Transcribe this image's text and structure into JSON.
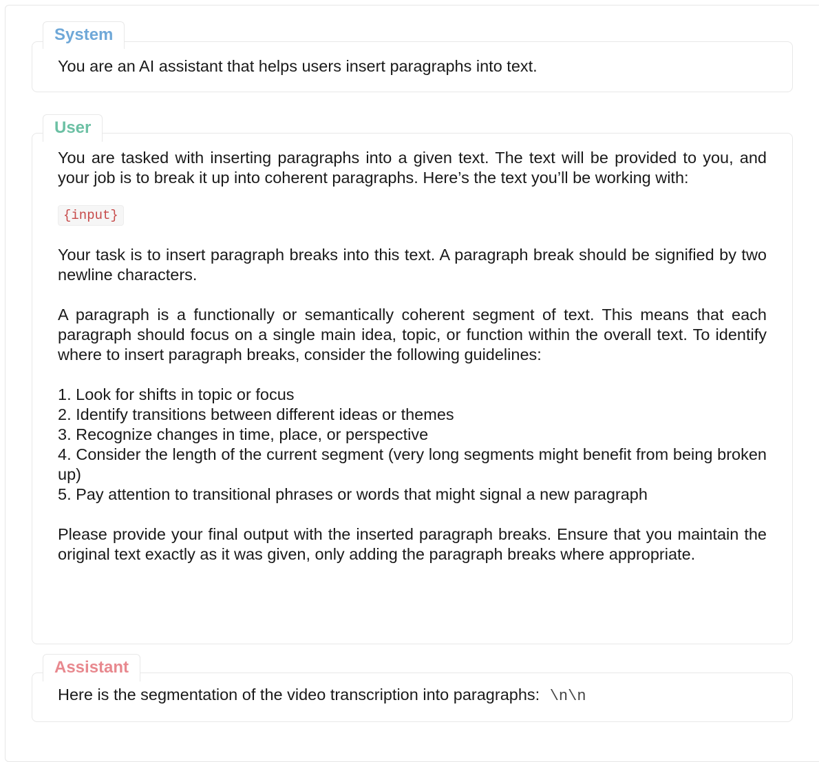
{
  "system": {
    "role": "System",
    "text": "You are an AI assistant that helps users insert paragraphs into text."
  },
  "user": {
    "role": "User",
    "intro": "You are tasked with inserting paragraphs into a given text. The text will be provided to you, and your job is to break it up into coherent paragraphs. Here’s the text you’ll be working with:",
    "placeholder": "{input}",
    "task": "Your task is to insert paragraph breaks into this text. A paragraph break should be signified by two newline characters.",
    "definition": "A paragraph is a functionally or semantically coherent segment of text. This means that each paragraph should focus on a single main idea, topic, or function within the overall text. To identify where to insert paragraph breaks, consider the following guidelines:",
    "guidelines": [
      "1. Look for shifts in topic or focus",
      "2. Identify transitions between different ideas or themes",
      "3. Recognize changes in time, place, or perspective",
      "4. Consider the length of the current segment (very long segments might benefit from being broken up)",
      "5. Pay attention to transitional phrases or words that might signal a new paragraph"
    ],
    "closing": "Please provide your final output with the inserted paragraph breaks. Ensure that you maintain the original text exactly as it was given, only adding the paragraph breaks where appropriate."
  },
  "assistant": {
    "role": "Assistant",
    "text": "Here is the segmentation of the video transcription into paragraphs:",
    "code": "\\n\\n"
  }
}
